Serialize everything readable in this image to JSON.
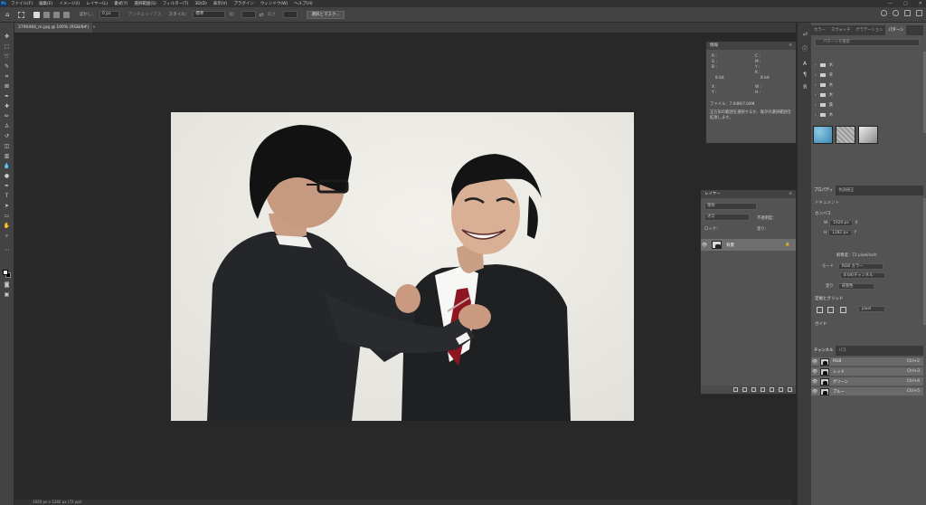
{
  "menubar": {
    "logo": "Ps",
    "items": [
      "ファイル(F)",
      "編集(E)",
      "イメージ(I)",
      "レイヤー(L)",
      "書式(Y)",
      "選択範囲(S)",
      "フィルター(T)",
      "3D(D)",
      "表示(V)",
      "プラグイン",
      "ウィンドウ(W)",
      "ヘルプ(H)"
    ],
    "window_controls": [
      "—",
      "▢",
      "✕"
    ]
  },
  "options": {
    "feather_label": "ぼかし：",
    "feather_value": "0 px",
    "antialias_label": "アンチエイリアス",
    "style_label": "スタイル：",
    "style_value": "標準",
    "width_label": "幅：",
    "height_label": "高さ：",
    "select_mask_button": "選択とマスク..."
  },
  "document": {
    "tab_title": "2790464_m.jpg @ 100% (RGB/8#)",
    "close": "×"
  },
  "status": {
    "text": "1920 px x 1282 px (72 ppi)"
  },
  "info": {
    "title": "情報",
    "r": "R :",
    "g": "G :",
    "b": "B :",
    "c": "C :",
    "m": "M :",
    "y": "Y :",
    "k": "K :",
    "bit1": "8 bit",
    "bit2": "8 bit",
    "x": "X :",
    "yy": "Y :",
    "w": "W :",
    "h": "H :",
    "file": "ファイル：7.04M/7.04M",
    "hint": "正方形の範囲を選択するか、既存の選択範囲を拡張します。"
  },
  "layers": {
    "title": "レイヤー",
    "kind_label": "種類",
    "blend": "通常",
    "opacity_label": "不透明度：",
    "lock_label": "ロック：",
    "fill_label": "塗り：",
    "layer_name": "背景",
    "lock_icon": "🔒"
  },
  "dock": {
    "top_tabs": [
      "カラー",
      "スウォッチ",
      "グラデーション",
      "パターン"
    ],
    "search_placeholder": "パターンを検索",
    "folders": [
      "木",
      "草",
      "木",
      "木",
      "葉",
      "木"
    ],
    "prop_tabs": [
      "プロパティ",
      "色調補正"
    ],
    "prop_doc": "ドキュメント",
    "canvas_section": "カンバス",
    "w_label": "W",
    "w_value": "1920 px",
    "x_label": "X",
    "h_label": "H",
    "h_value": "1282 px",
    "y_label": "Y",
    "resolution": "解像度：72 pixel/inch",
    "mode_label": "モード",
    "mode_value": "RGB カラー",
    "bits_value": "8 bit/チャンネル",
    "fill_label": "塗り",
    "fill_value": "背景色",
    "rulers_section": "定規とグリッド",
    "units_value": "pixel",
    "guides_section": "ガイド",
    "channel_tabs": [
      "チャンネル",
      "パス"
    ],
    "channels": [
      {
        "name": "RGB",
        "key": "Ctrl+2"
      },
      {
        "name": "レッド",
        "key": "Ctrl+3"
      },
      {
        "name": "グリーン",
        "key": "Ctrl+4"
      },
      {
        "name": "ブルー",
        "key": "Ctrl+5"
      }
    ]
  },
  "colors": {
    "accent": "#31a8ff",
    "panel": "#535353",
    "canvas": "#282828"
  }
}
